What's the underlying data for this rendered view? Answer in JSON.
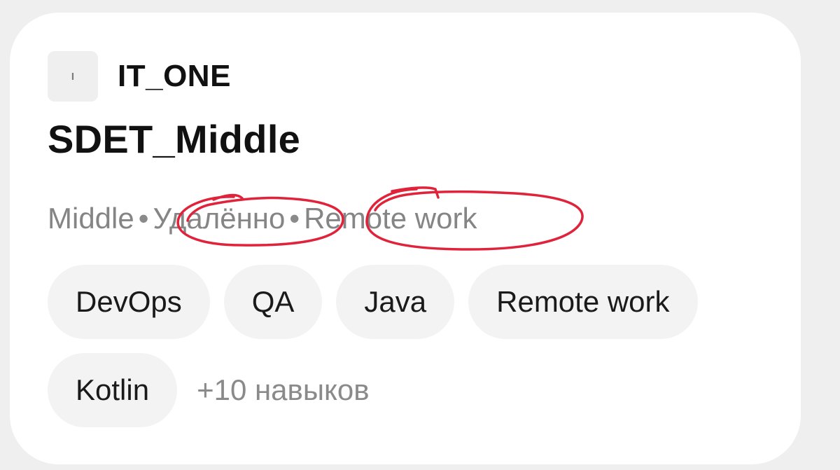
{
  "company": {
    "logo_letter": "I",
    "name": "IT_ONE"
  },
  "vacancy": {
    "title": "SDET_Middle"
  },
  "meta": {
    "level": "Middle",
    "separator": "•",
    "location_ru": "Удалённо",
    "location_en": "Remote work"
  },
  "skills": {
    "chips": [
      "DevOps",
      "QA",
      "Java",
      "Remote work",
      "Kotlin"
    ],
    "more_label": "+10 навыков"
  },
  "colors": {
    "page_bg": "#efefef",
    "card_bg": "#ffffff",
    "chip_bg": "#f3f3f3",
    "annotation": "#e0223a"
  }
}
